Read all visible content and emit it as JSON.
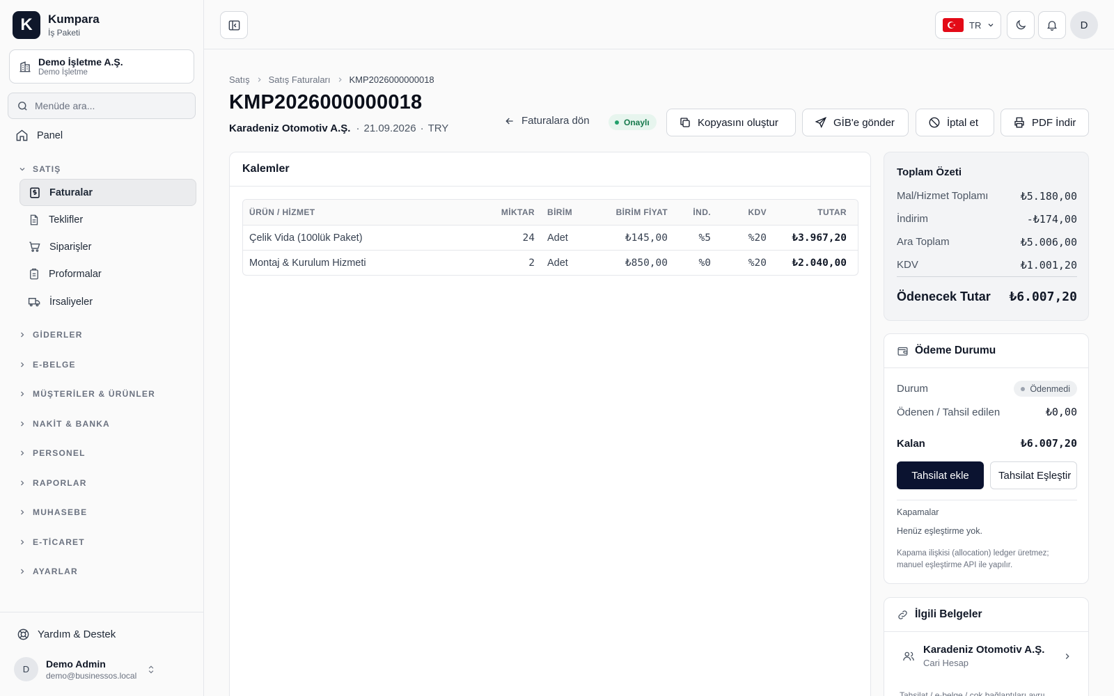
{
  "brand": {
    "logo_letter": "K",
    "name": "Kumpara",
    "subtitle": "İş Paketi"
  },
  "company": {
    "name": "Demo İşletme A.Ş.",
    "sub": "Demo İşletme"
  },
  "search": {
    "placeholder": "Menüde ara..."
  },
  "nav": {
    "panel": "Panel",
    "sections": {
      "satis": "SATIŞ",
      "giderler": "GİDERLER",
      "ebelge": "E-BELGE",
      "musteriler": "MÜŞTERİLER & ÜRÜNLER",
      "nakit": "NAKİT & BANKA",
      "personel": "PERSONEL",
      "raporlar": "RAPORLAR",
      "muhasebe": "MUHASEBE",
      "eticaret": "E-TİCARET",
      "ayarlar": "AYARLAR"
    },
    "satis_items": [
      "Faturalar",
      "Teklifler",
      "Siparişler",
      "Proformalar",
      "İrsaliyeler"
    ]
  },
  "footer": {
    "help": "Yardım & Destek",
    "user_initial": "D",
    "user_name": "Demo Admin",
    "user_email": "demo@businessos.local"
  },
  "topbar": {
    "lang": "TR",
    "avatar": "D"
  },
  "breadcrumb": [
    "Satış",
    "Satış Faturaları",
    "KMP2026000000018"
  ],
  "invoice": {
    "number": "KMP2026000000018",
    "customer": "Karadeniz Otomotiv A.Ş.",
    "date": "21.09.2026",
    "currency": "TRY",
    "status": "Onaylı"
  },
  "actions": {
    "back": "Faturalara dön",
    "copy": "Kopyasını oluştur",
    "gib": "GİB'e gönder",
    "cancel": "İptal et",
    "pdf": "PDF İndir"
  },
  "items": {
    "title": "Kalemler",
    "columns": [
      "ÜRÜN / HİZMET",
      "MİKTAR",
      "BİRİM",
      "BİRİM FİYAT",
      "İND.",
      "KDV",
      "TUTAR"
    ],
    "rows": [
      {
        "product": "Çelik Vida (100lük Paket)",
        "qty": "24",
        "unit": "Adet",
        "price": "₺145,00",
        "discount": "%5",
        "kdv": "%20",
        "total": "₺3.967,20"
      },
      {
        "product": "Montaj & Kurulum Hizmeti",
        "qty": "2",
        "unit": "Adet",
        "price": "₺850,00",
        "discount": "%0",
        "kdv": "%20",
        "total": "₺2.040,00"
      }
    ]
  },
  "summary": {
    "title": "Toplam Özeti",
    "rows": [
      {
        "label": "Mal/Hizmet Toplamı",
        "value": "₺5.180,00"
      },
      {
        "label": "İndirim",
        "value": "-₺174,00"
      },
      {
        "label": "Ara Toplam",
        "value": "₺5.006,00"
      },
      {
        "label": "KDV",
        "value": "₺1.001,20"
      }
    ],
    "total_label": "Ödenecek Tutar",
    "total_value": "₺6.007,20"
  },
  "payment": {
    "title": "Ödeme Durumu",
    "status_label": "Durum",
    "status_value": "Ödenmedi",
    "paid_label": "Ödenen / Tahsil edilen",
    "paid_value": "₺0,00",
    "remaining_label": "Kalan",
    "remaining_value": "₺6.007,20",
    "add_button": "Tahsilat ekle",
    "match_button": "Tahsilat Eşleştir",
    "closures_title": "Kapamalar",
    "closures_empty": "Henüz eşleştirme yok.",
    "closures_note": "Kapama ilişkisi (allocation) ledger üretmez; manuel eşleştirme API ile yapılır."
  },
  "related": {
    "title": "İlgili Belgeler",
    "item_name": "Karadeniz Otomotiv A.Ş.",
    "item_sub": "Cari Hesap",
    "note": "Tahsilat / e-belge / çok bağlantıları ayrıı"
  }
}
